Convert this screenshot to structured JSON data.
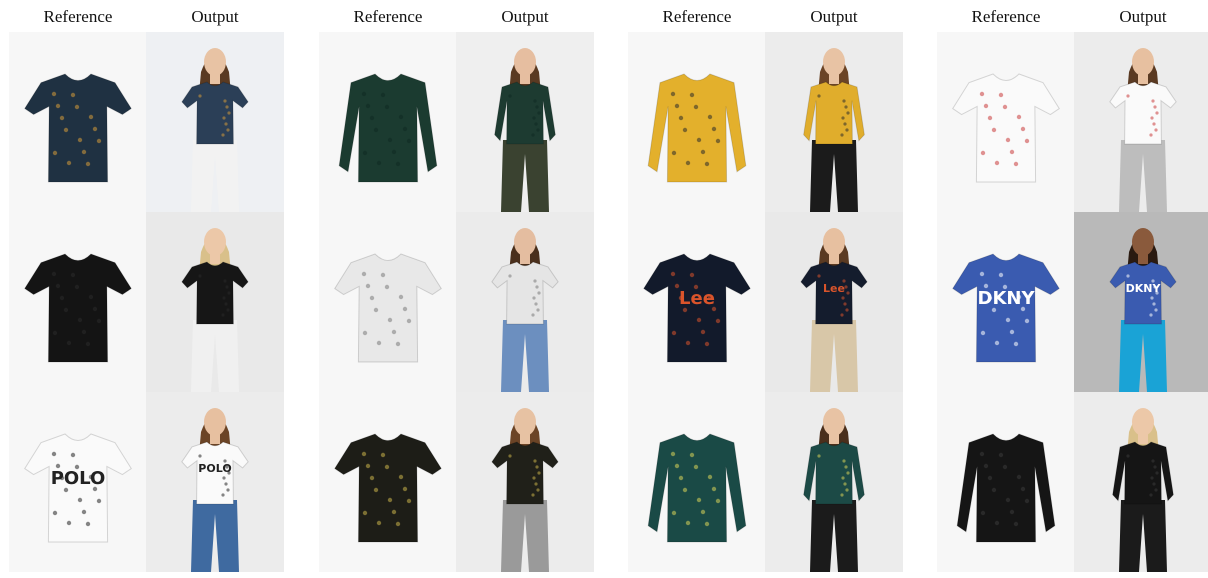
{
  "headers": {
    "reference": "Reference",
    "output": "Output"
  },
  "groups": [
    {
      "rows": [
        {
          "ref": {
            "kind": "blouse",
            "garment": "#1f3142",
            "accent": "#d39a3a",
            "bg": "#f7f7f7",
            "text": ""
          },
          "out": {
            "kind": "blouse",
            "garment": "#2b3f57",
            "accent": "#d39a3a",
            "bg": "#eef0f3",
            "skin": "#e8c3a4",
            "hair": "#5a3a22",
            "pants": "#f2f2f2",
            "text": ""
          }
        },
        {
          "ref": {
            "kind": "tee",
            "garment": "#141414",
            "accent": "#2a2a2a",
            "bg": "#f7f7f7",
            "text": ""
          },
          "out": {
            "kind": "tee",
            "garment": "#161616",
            "accent": "#2a2a2a",
            "bg": "#e9e9e9",
            "skin": "#ecc8a8",
            "hair": "#d9c08a",
            "pants": "#f0f0f0",
            "text": ""
          }
        },
        {
          "ref": {
            "kind": "tee",
            "garment": "#fafafa",
            "accent": "#222222",
            "bg": "#f7f7f7",
            "text": "POLO"
          },
          "out": {
            "kind": "tee",
            "garment": "#fafafa",
            "accent": "#222222",
            "bg": "#ececec",
            "skin": "#e7c0a0",
            "hair": "#6b4426",
            "pants": "#3f6aa0",
            "text": "POLO"
          }
        }
      ]
    },
    {
      "rows": [
        {
          "ref": {
            "kind": "longsleeve",
            "garment": "#1b3b30",
            "accent": "#0f2a22",
            "bg": "#f7f7f7",
            "text": ""
          },
          "out": {
            "kind": "longsleeve",
            "garment": "#1d3b31",
            "accent": "#0f2a22",
            "bg": "#efefef",
            "skin": "#e6bea0",
            "hair": "#5a3a22",
            "pants": "#3a4230",
            "text": ""
          }
        },
        {
          "ref": {
            "kind": "tee",
            "garment": "#e8e8e8",
            "accent": "#7a7a7a",
            "bg": "#f7f7f7",
            "text": ""
          },
          "out": {
            "kind": "tee",
            "garment": "#e5e5e5",
            "accent": "#7a7a7a",
            "bg": "#ebebeb",
            "skin": "#e4bda0",
            "hair": "#4a2f1c",
            "pants": "#6c8fbf",
            "text": ""
          }
        },
        {
          "ref": {
            "kind": "tee",
            "garment": "#1d1d17",
            "accent": "#c9b24a",
            "bg": "#f7f7f7",
            "text": ""
          },
          "out": {
            "kind": "tee",
            "garment": "#202019",
            "accent": "#c9b24a",
            "bg": "#ececec",
            "skin": "#e7c2a3",
            "hair": "#6b4426",
            "pants": "#9a9a9a",
            "text": ""
          }
        }
      ]
    },
    {
      "rows": [
        {
          "ref": {
            "kind": "longsleeve",
            "garment": "#e3b02c",
            "accent": "#2c2c2c",
            "bg": "#f7f7f7",
            "text": ""
          },
          "out": {
            "kind": "longsleeve",
            "garment": "#e0ad2c",
            "accent": "#2c2c2c",
            "bg": "#ececec",
            "skin": "#e8c3a4",
            "hair": "#6b4426",
            "pants": "#1b1b1b",
            "text": ""
          }
        },
        {
          "ref": {
            "kind": "tee",
            "garment": "#121a2b",
            "accent": "#d9542b",
            "bg": "#f7f7f7",
            "text": "Lee"
          },
          "out": {
            "kind": "tee",
            "garment": "#141c2d",
            "accent": "#d9542b",
            "bg": "#e9e9e9",
            "skin": "#e7c0a0",
            "hair": "#5a3a22",
            "pants": "#d8c7a8",
            "text": "Lee"
          }
        },
        {
          "ref": {
            "kind": "longsleeve",
            "garment": "#1a4a46",
            "accent": "#d9d45a",
            "bg": "#f7f7f7",
            "text": ""
          },
          "out": {
            "kind": "longsleeve",
            "garment": "#1c4a46",
            "accent": "#d9d45a",
            "bg": "#ececec",
            "skin": "#e8c3a4",
            "hair": "#4a2f1c",
            "pants": "#1b1b1b",
            "text": ""
          }
        }
      ]
    },
    {
      "rows": [
        {
          "ref": {
            "kind": "tee",
            "garment": "#fafafa",
            "accent": "#c83a3a",
            "bg": "#f7f7f7",
            "text": ""
          },
          "out": {
            "kind": "tee",
            "garment": "#fafafa",
            "accent": "#c83a3a",
            "bg": "#ececec",
            "skin": "#e7c0a0",
            "hair": "#5a3a22",
            "pants": "#bdbdbd",
            "text": ""
          }
        },
        {
          "ref": {
            "kind": "tee",
            "garment": "#3a5bb0",
            "accent": "#ffffff",
            "bg": "#f7f7f7",
            "text": "DKNY"
          },
          "out": {
            "kind": "tee",
            "garment": "#3a5bb0",
            "accent": "#ffffff",
            "bg": "#b9b9b9",
            "skin": "#8a5a3c",
            "hair": "#2a1a10",
            "pants": "#1aa3d6",
            "text": "DKNY"
          }
        },
        {
          "ref": {
            "kind": "longsleeve",
            "garment": "#151515",
            "accent": "#3a3a3a",
            "bg": "#f7f7f7",
            "text": ""
          },
          "out": {
            "kind": "longsleeve",
            "garment": "#151515",
            "accent": "#3a3a3a",
            "bg": "#ececec",
            "skin": "#ecc8a8",
            "hair": "#d9c08a",
            "pants": "#1b1b1b",
            "text": ""
          }
        }
      ]
    }
  ]
}
